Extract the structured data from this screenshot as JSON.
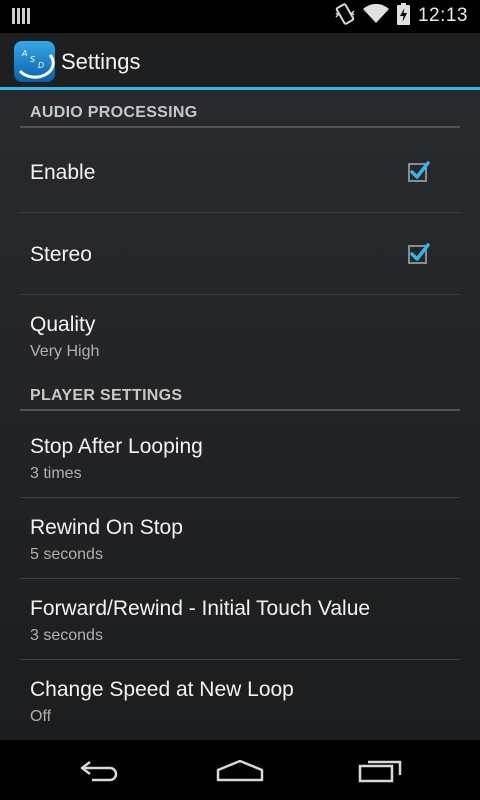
{
  "status_bar": {
    "time": "12:13",
    "icons": [
      "notification-bars-icon",
      "vibrate-icon",
      "wifi-icon",
      "battery-charging-icon"
    ]
  },
  "action_bar": {
    "title": "Settings",
    "app_icon": "asd-app-icon",
    "app_icon_letters": "ASD"
  },
  "sections": {
    "audio": {
      "header": "AUDIO PROCESSING",
      "enable": {
        "title": "Enable",
        "checked": true
      },
      "stereo": {
        "title": "Stereo",
        "checked": true
      },
      "quality": {
        "title": "Quality",
        "summary": "Very High"
      }
    },
    "player": {
      "header": "PLAYER SETTINGS",
      "stop_after_looping": {
        "title": "Stop After Looping",
        "summary": "3 times"
      },
      "rewind_on_stop": {
        "title": "Rewind On Stop",
        "summary": "5 seconds"
      },
      "forward_rewind": {
        "title": "Forward/Rewind - Initial Touch Value",
        "summary": "3 seconds"
      },
      "change_speed": {
        "title": "Change Speed at New Loop",
        "summary": "Off"
      }
    }
  },
  "nav_bar": {
    "icons": [
      "back-icon",
      "home-icon",
      "recent-apps-icon"
    ]
  },
  "colors": {
    "accent": "#33b5e5",
    "background": "#232528",
    "divider": "#3b3e42"
  }
}
